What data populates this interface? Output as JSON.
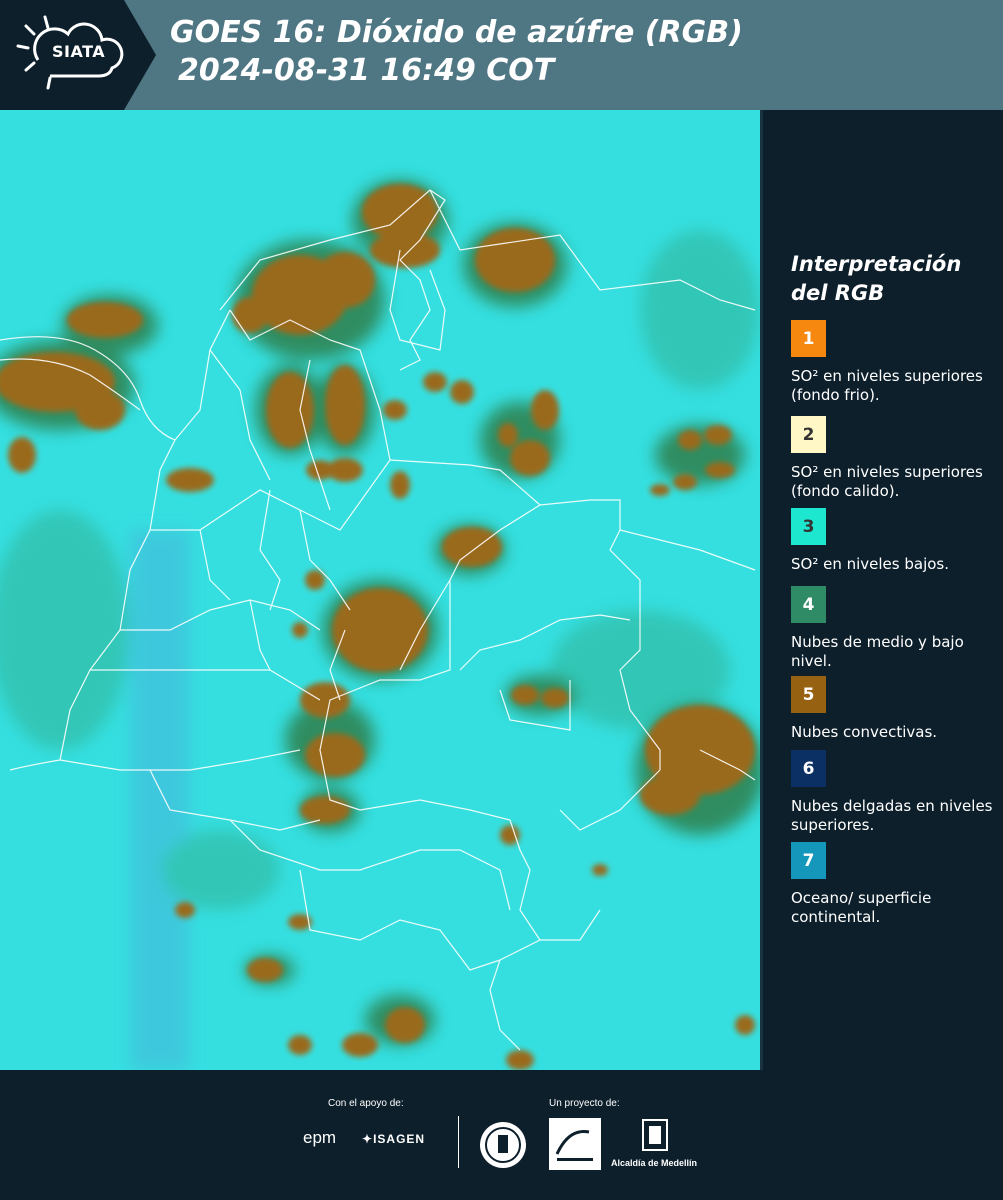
{
  "header": {
    "logo_text": "SIATA",
    "title_line1": "GOES 16: Dióxido de azúfre (RGB)",
    "title_line2": "2024-08-31 16:49 COT"
  },
  "legend": {
    "title": "Interpretación del RGB",
    "items": [
      {
        "number": "1",
        "color": "#f6870f",
        "text_color": "#ffffff",
        "label": "SO² en niveles superiores (fondo frio)."
      },
      {
        "number": "2",
        "color": "#fff8c6",
        "text_color": "#333333",
        "label": "SO² en niveles superiores (fondo calido)."
      },
      {
        "number": "3",
        "color": "#1de8cf",
        "text_color": "#333333",
        "label": "SO² en niveles bajos."
      },
      {
        "number": "4",
        "color": "#2f8a66",
        "text_color": "#ffffff",
        "label": "Nubes de medio y bajo nivel."
      },
      {
        "number": "5",
        "color": "#976112",
        "text_color": "#ffffff",
        "label": "Nubes convectivas."
      },
      {
        "number": "6",
        "color": "#0b3164",
        "text_color": "#ffffff",
        "label": "Nubes delgadas en niveles superiores."
      },
      {
        "number": "7",
        "color": "#1497bb",
        "text_color": "#ffffff",
        "label": "Oceano/ superficie continental."
      }
    ]
  },
  "footer": {
    "support_label": "Con el apoyo de:",
    "project_label": "Un proyecto de:",
    "sponsors": [
      "epm",
      "ISAGEN"
    ],
    "partners": [
      "Alcaldía de Medellín"
    ]
  },
  "colors": {
    "background": "#35dfe0",
    "cloud_convective": "#9a6a1f",
    "cloud_mid": "#3a8c5a",
    "border": "#ffffff",
    "header": "#4f7683",
    "panel": "#0d1f2b"
  }
}
